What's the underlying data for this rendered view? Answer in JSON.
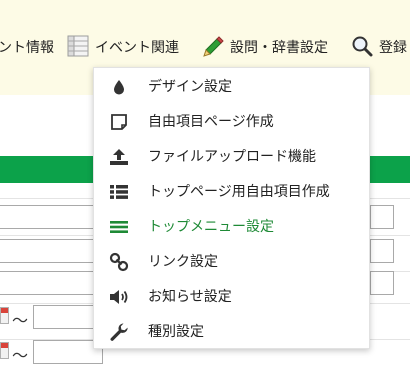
{
  "nav": {
    "items": [
      {
        "label": "ント情報",
        "icon": "none"
      },
      {
        "label": "イベント関連",
        "icon": "list-grid-icon"
      },
      {
        "label": "設問・辞書設定",
        "icon": "pencil-icon"
      },
      {
        "label": "登録",
        "icon": "search-icon"
      }
    ]
  },
  "form": {
    "tilde": "～"
  },
  "menu": {
    "items": [
      {
        "label": "デザイン設定",
        "icon": "droplet-icon",
        "active": false
      },
      {
        "label": "自由項目ページ作成",
        "icon": "page-icon",
        "active": false
      },
      {
        "label": "ファイルアップロード機能",
        "icon": "upload-icon",
        "active": false
      },
      {
        "label": "トップページ用自由項目作成",
        "icon": "list-icon",
        "active": false
      },
      {
        "label": "トップメニュー設定",
        "icon": "menu-lines-icon",
        "active": true
      },
      {
        "label": "リンク設定",
        "icon": "link-icon",
        "active": false
      },
      {
        "label": "お知らせ設定",
        "icon": "speaker-icon",
        "active": false
      },
      {
        "label": "種別設定",
        "icon": "wrench-icon",
        "active": false
      }
    ]
  },
  "colors": {
    "nav_background": "#fdfbe6",
    "header_band": "#0ca24a",
    "active_menu_text": "#1e8a36",
    "menu_icon": "#333333"
  }
}
